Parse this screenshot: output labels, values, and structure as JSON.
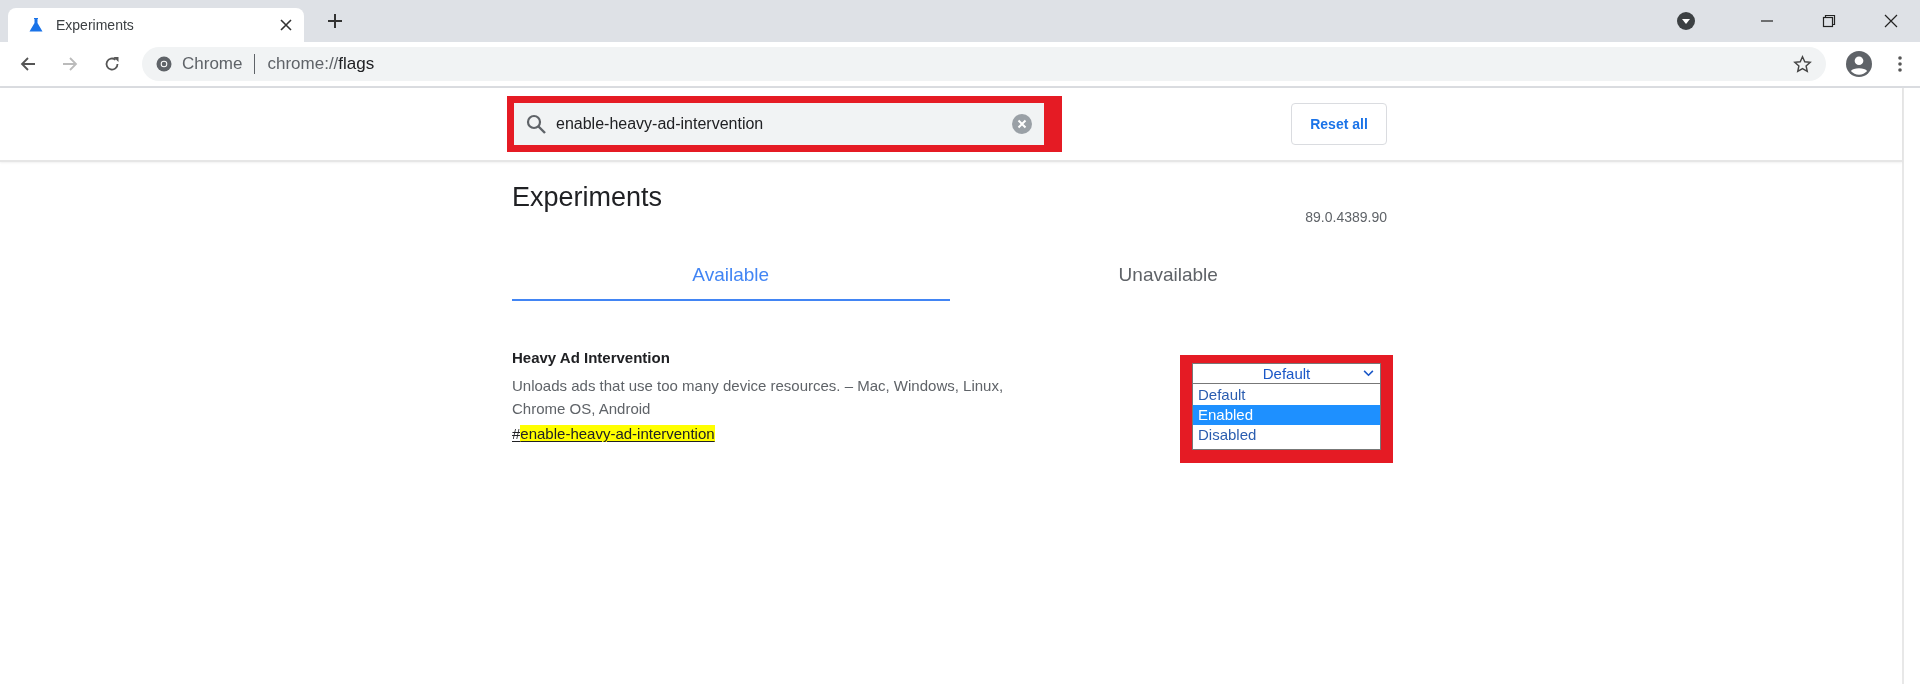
{
  "browser": {
    "tabs": [
      {
        "title": "Experiments",
        "selected": true
      }
    ],
    "address_bar": {
      "origin": "Chrome",
      "url_scheme": "chrome://",
      "url_path": "flags"
    }
  },
  "header": {
    "search": {
      "value": "enable-heavy-ad-intervention",
      "highlighted": true
    },
    "reset_button": "Reset all"
  },
  "page": {
    "title": "Experiments",
    "version": "89.0.4389.90",
    "tabs": [
      {
        "label": "Available",
        "selected": true
      },
      {
        "label": "Unavailable",
        "selected": false
      }
    ],
    "flags": [
      {
        "name": "Heavy Ad Intervention",
        "description": "Unloads ads that use too many device resources. – Mac, Windows, Linux, Chrome OS, Android",
        "hash": "#",
        "id": "enable-heavy-ad-intervention",
        "id_highlighted": true,
        "select": {
          "value": "Default",
          "expanded": true,
          "highlighted": true,
          "options": [
            {
              "label": "Default",
              "highlighted": false
            },
            {
              "label": "Enabled",
              "highlighted": true
            },
            {
              "label": "Disabled",
              "highlighted": false
            }
          ]
        }
      }
    ]
  }
}
